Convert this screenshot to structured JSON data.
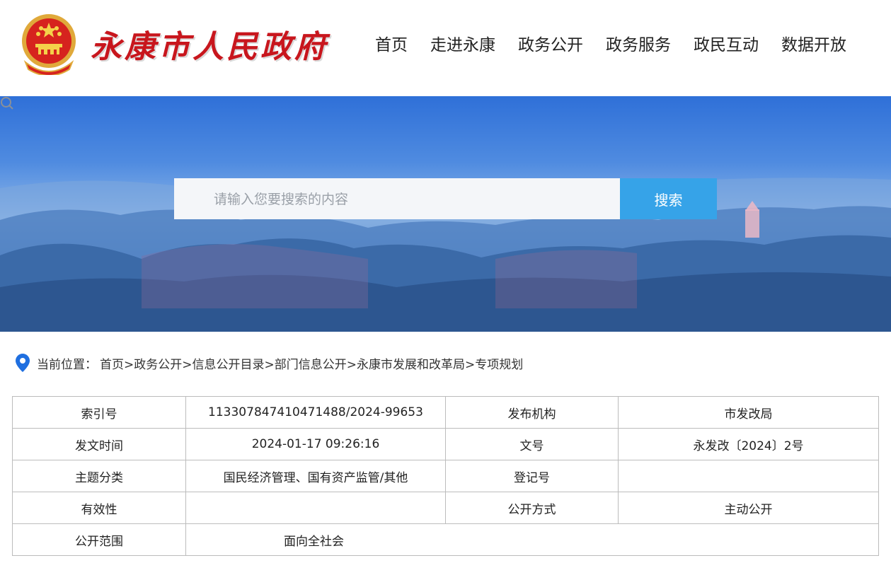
{
  "header": {
    "emblem_icon": "national-emblem-icon",
    "title": "永康市人民政府",
    "title_color": "#c8161d",
    "nav": [
      {
        "label": "首页"
      },
      {
        "label": "走进永康"
      },
      {
        "label": "政务公开"
      },
      {
        "label": "政务服务"
      },
      {
        "label": "政民互动"
      },
      {
        "label": "数据开放"
      }
    ]
  },
  "search": {
    "placeholder": "请输入您要搜索的内容",
    "button_label": "搜索",
    "button_color": "#36a3e8"
  },
  "breadcrumb": {
    "label": "当前位置：",
    "items": [
      "首页>",
      "政务公开>",
      "信息公开目录>",
      "部门信息公开>",
      "永康市发展和改革局>",
      "专项规划"
    ]
  },
  "meta_table": {
    "rows": [
      [
        "索引号",
        "11330784741047148​8/2024-99653",
        "发布机构",
        "市发改局"
      ],
      [
        "发文时间",
        "2024-01-17 09:26:16",
        "文号",
        "永发改〔2024〕2号"
      ],
      [
        "主题分类",
        "国民经济管理、国有资产监管/其他",
        "登记号",
        ""
      ],
      [
        "有效性",
        "",
        "公开方式",
        "主动公开"
      ],
      [
        "公开范围",
        "面向全社会"
      ]
    ]
  }
}
